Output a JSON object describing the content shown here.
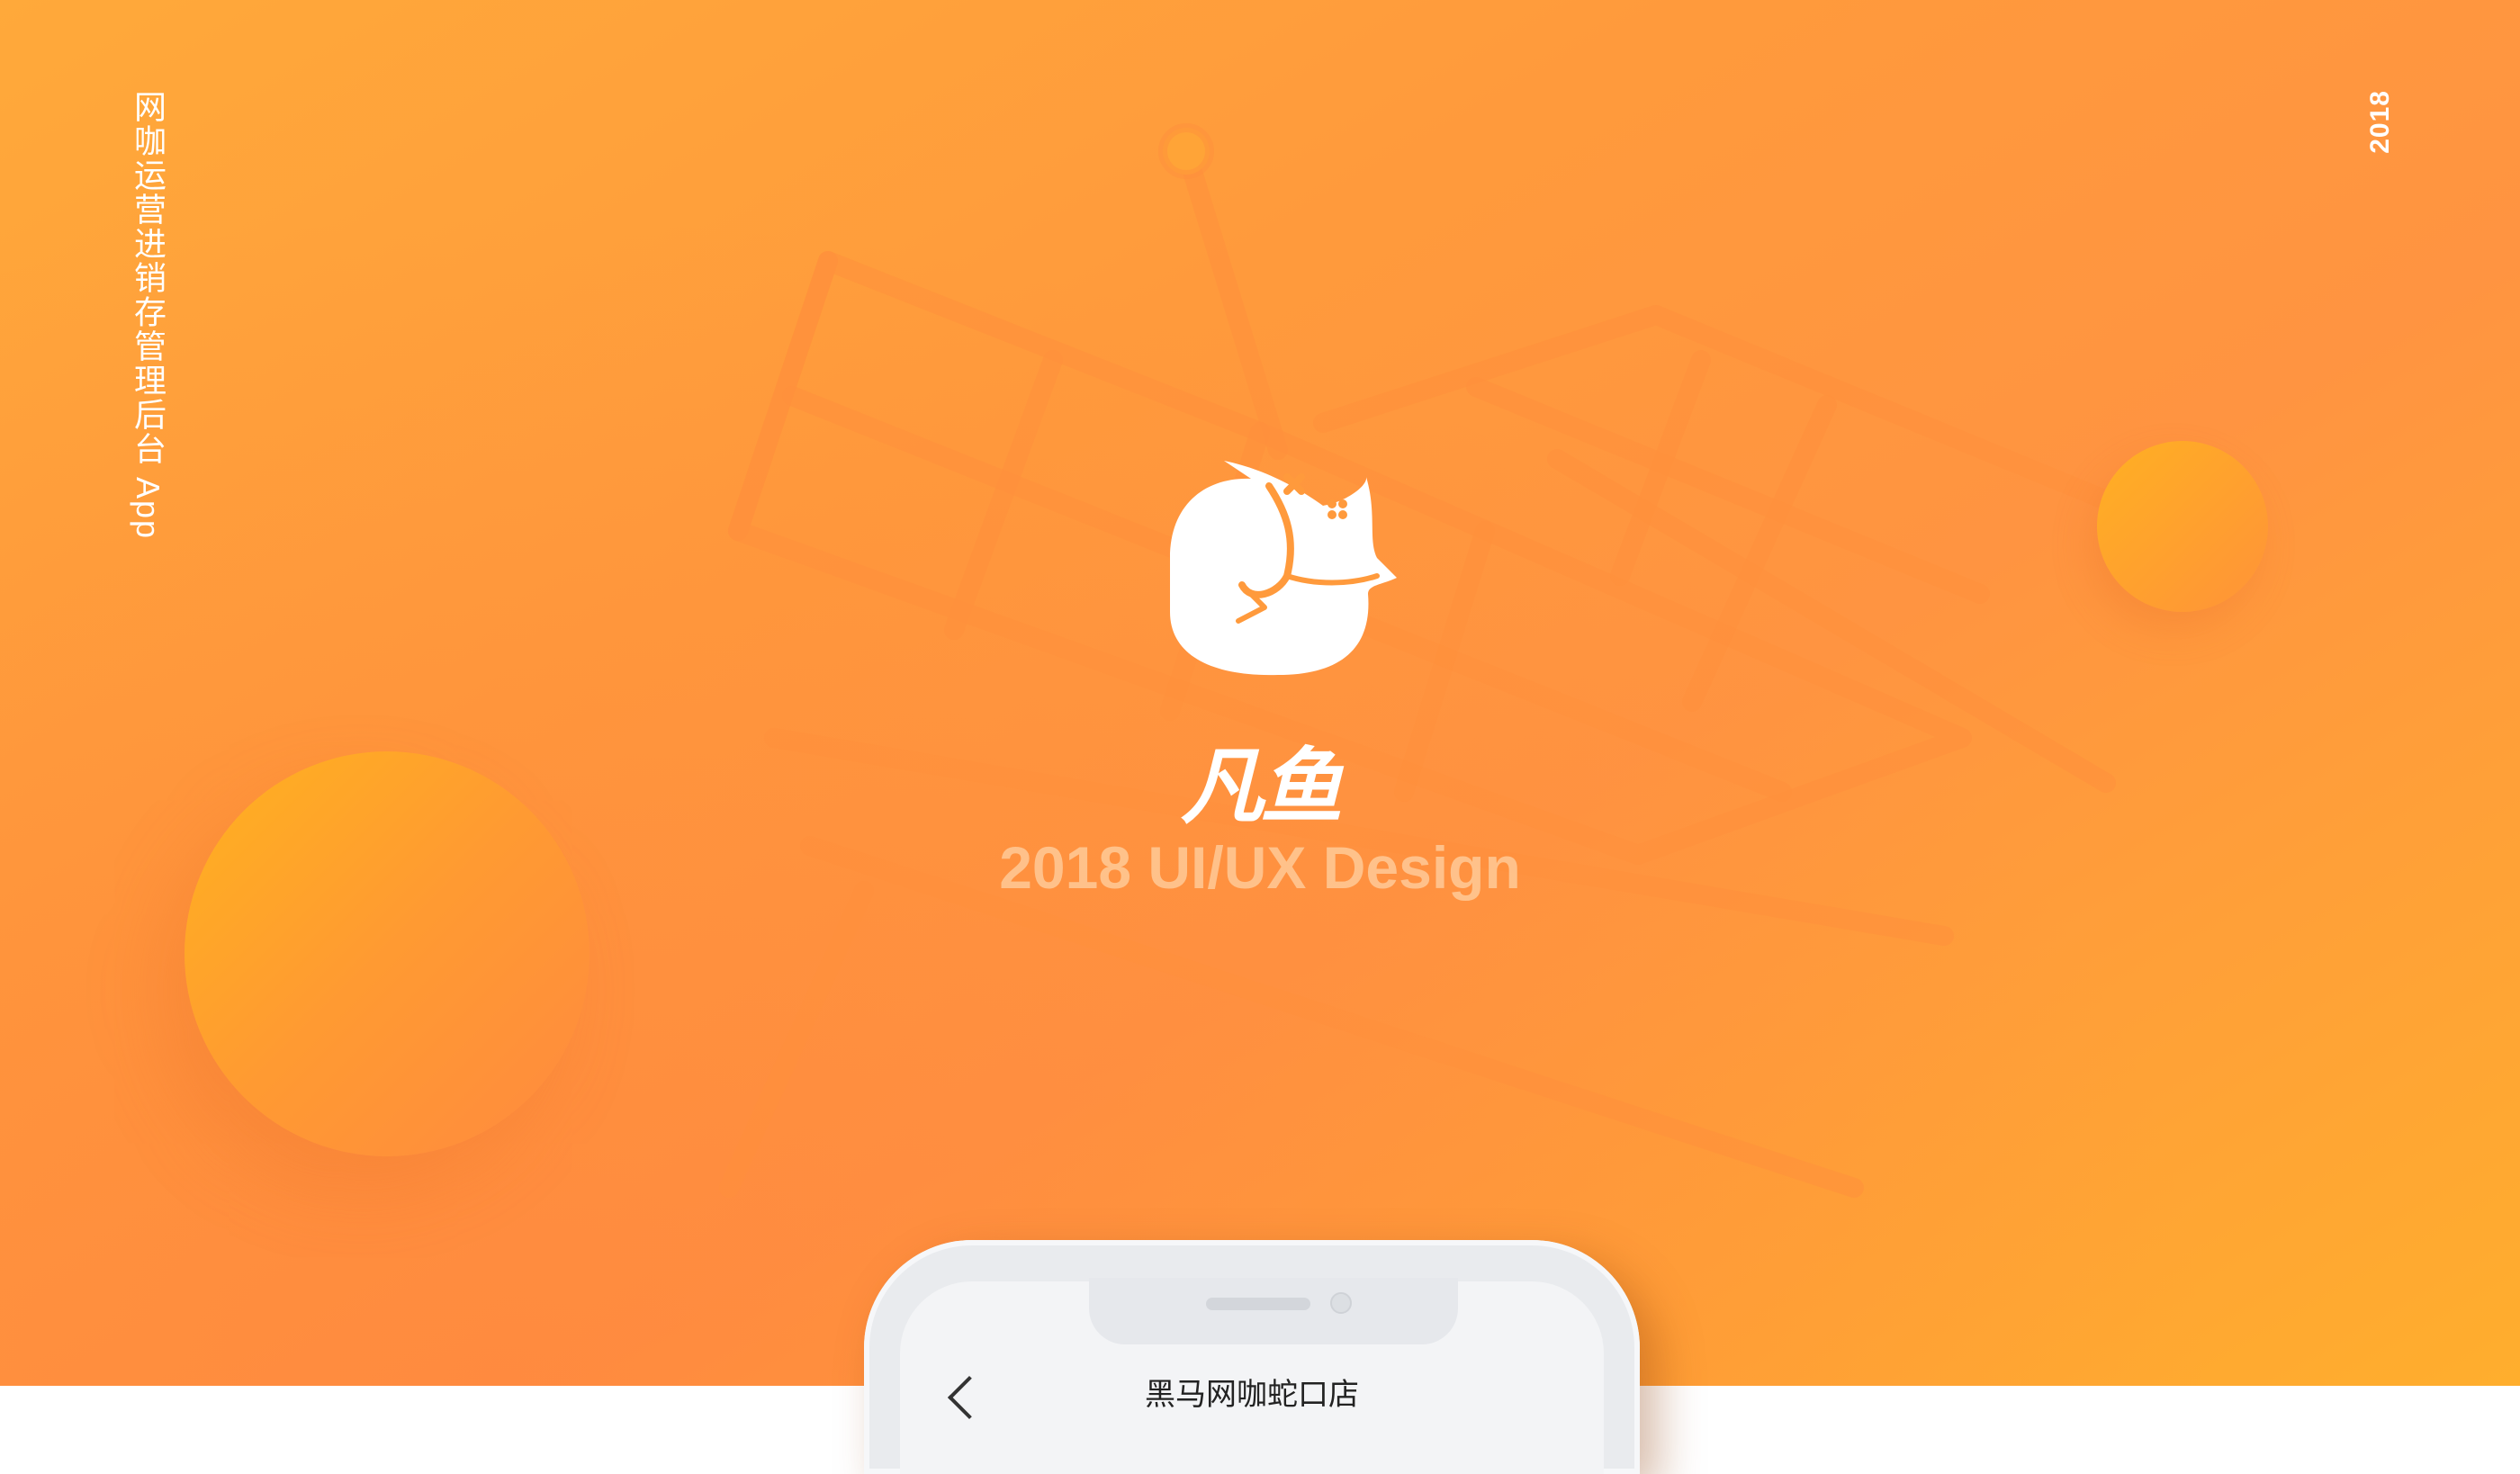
{
  "header": {
    "vertical_title": "网咖运营进销存管理后台 App",
    "year": "2018"
  },
  "logo": {
    "mark_icon": "fox-gamepad-icon",
    "brand_text": "凡鱼"
  },
  "tagline": "2018  UI/UX Design",
  "phone": {
    "screen_title": "黑马网咖蛇口店",
    "back_icon": "back-arrow-icon"
  },
  "colors": {
    "accent": "#ff9a3c",
    "accent_light": "#ffb21f"
  }
}
